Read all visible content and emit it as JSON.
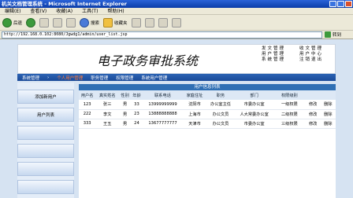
{
  "window": {
    "title": "机关文档管理系统 - Microsoft Internet Explorer"
  },
  "menu": [
    "编辑(E)",
    "查看(V)",
    "收藏(A)",
    "工具(T)",
    "帮助(H)"
  ],
  "toolbar": {
    "back": "后退",
    "search": "搜索",
    "favorites": "收藏夹"
  },
  "address": {
    "url": "http://192.168.0.102:8080/Jgwdg1/admin/user_list.jsp",
    "go": "转到"
  },
  "banner": {
    "title": "电子政务审批系统",
    "links": [
      "发文管理",
      "收文管理",
      "用户管理",
      "用户中心",
      "系统管理",
      "注销退出"
    ]
  },
  "nav": {
    "items": [
      "系统管理",
      "个人用户管理",
      "职务管理",
      "权限管理",
      "系统用户管理"
    ],
    "active_index": 1
  },
  "sidebar": {
    "items": [
      "添加新用户",
      "用户列表"
    ]
  },
  "table": {
    "caption": "用户信息列表",
    "headers": [
      "用户名",
      "真实姓名",
      "性别",
      "年龄",
      "联系电话",
      "家庭住址",
      "职务",
      "部门",
      "权限级别",
      "",
      ""
    ],
    "rows": [
      [
        "123",
        "张三",
        "男",
        "33",
        "13999999999",
        "沈阳市",
        "办公室主任",
        "市委办公室",
        "一级权限",
        "修改",
        "删除"
      ],
      [
        "222",
        "李文",
        "男",
        "23",
        "13888888888",
        "上海市",
        "办公文员",
        "人大常委办公室",
        "二级权限",
        "修改",
        "删除"
      ],
      [
        "333",
        "王五",
        "男",
        "24",
        "13677777777",
        "天津市",
        "办公文员",
        "市委办公室",
        "三级权限",
        "修改",
        "删除"
      ]
    ]
  }
}
